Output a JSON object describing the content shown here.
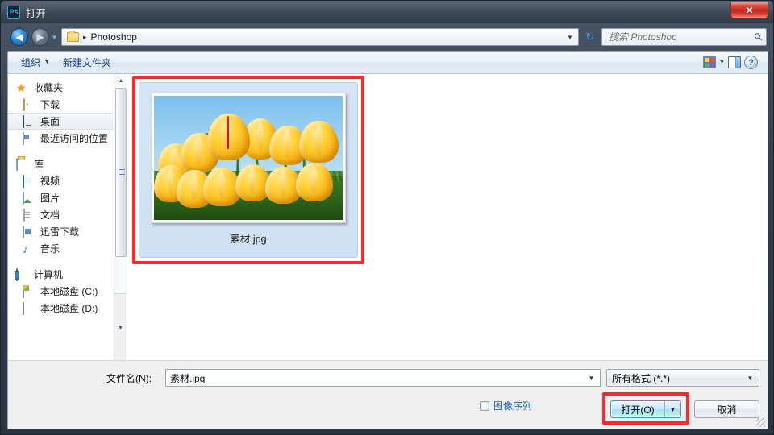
{
  "window": {
    "title": "打开",
    "app_icon": "photoshop-icon",
    "app_icon_text": "Ps",
    "close_label": "✕"
  },
  "nav": {
    "back_icon": "back-arrow-icon",
    "forward_icon": "forward-arrow-icon",
    "history_icon": "chevron-down-icon",
    "address": {
      "folder_icon": "folder-icon",
      "separator": "▸",
      "crumb": "Photoshop",
      "dropdown_icon": "chevron-down-icon"
    },
    "refresh_icon": "refresh-icon",
    "search": {
      "placeholder": "搜索 Photoshop",
      "value": "",
      "icon": "search-icon"
    }
  },
  "commandbar": {
    "organize": "组织",
    "new_folder": "新建文件夹",
    "caret": "▼",
    "view_icon": "view-mode-icon",
    "view_caret": "▼",
    "preview_pane_icon": "preview-pane-icon",
    "help_icon": "help-icon",
    "help_glyph": "?"
  },
  "sidebar": {
    "groups": [
      {
        "header": {
          "label": "收藏夹",
          "icon": "star-icon"
        },
        "items": [
          {
            "label": "下载",
            "icon": "downloads-icon",
            "selected": false
          },
          {
            "label": "桌面",
            "icon": "desktop-icon",
            "selected": true
          },
          {
            "label": "最近访问的位置",
            "icon": "recent-places-icon",
            "selected": false
          }
        ]
      },
      {
        "header": {
          "label": "库",
          "icon": "library-icon"
        },
        "items": [
          {
            "label": "视频",
            "icon": "videos-icon",
            "selected": false
          },
          {
            "label": "图片",
            "icon": "pictures-icon",
            "selected": false
          },
          {
            "label": "文档",
            "icon": "documents-icon",
            "selected": false
          },
          {
            "label": "迅雷下载",
            "icon": "thunder-download-icon",
            "selected": false
          },
          {
            "label": "音乐",
            "icon": "music-icon",
            "selected": false
          }
        ]
      },
      {
        "header": {
          "label": "计算机",
          "icon": "computer-icon"
        },
        "items": [
          {
            "label": "本地磁盘 (C:)",
            "icon": "system-drive-icon",
            "selected": false
          },
          {
            "label": "本地磁盘 (D:)",
            "icon": "drive-icon",
            "selected": false
          }
        ]
      }
    ],
    "scrollbar": {
      "up_arrow": "▲",
      "down_arrow": "▼"
    }
  },
  "filelist": {
    "items": [
      {
        "name": "素材.jpg",
        "selected": true,
        "thumbnail": "yellow-tulips-photo"
      }
    ],
    "highlight_color": "#fc2a2a"
  },
  "form": {
    "filename_label": "文件名(N):",
    "filename_value": "素材.jpg",
    "filename_caret": "▼",
    "filetype_value": "所有格式 (*.*)",
    "filetype_caret": "▼",
    "image_sequence_label": "图像序列",
    "image_sequence_checked": false,
    "open_label": "打开(O)",
    "open_caret": "▼",
    "cancel_label": "取消",
    "highlight_color": "#fc2a2a"
  }
}
